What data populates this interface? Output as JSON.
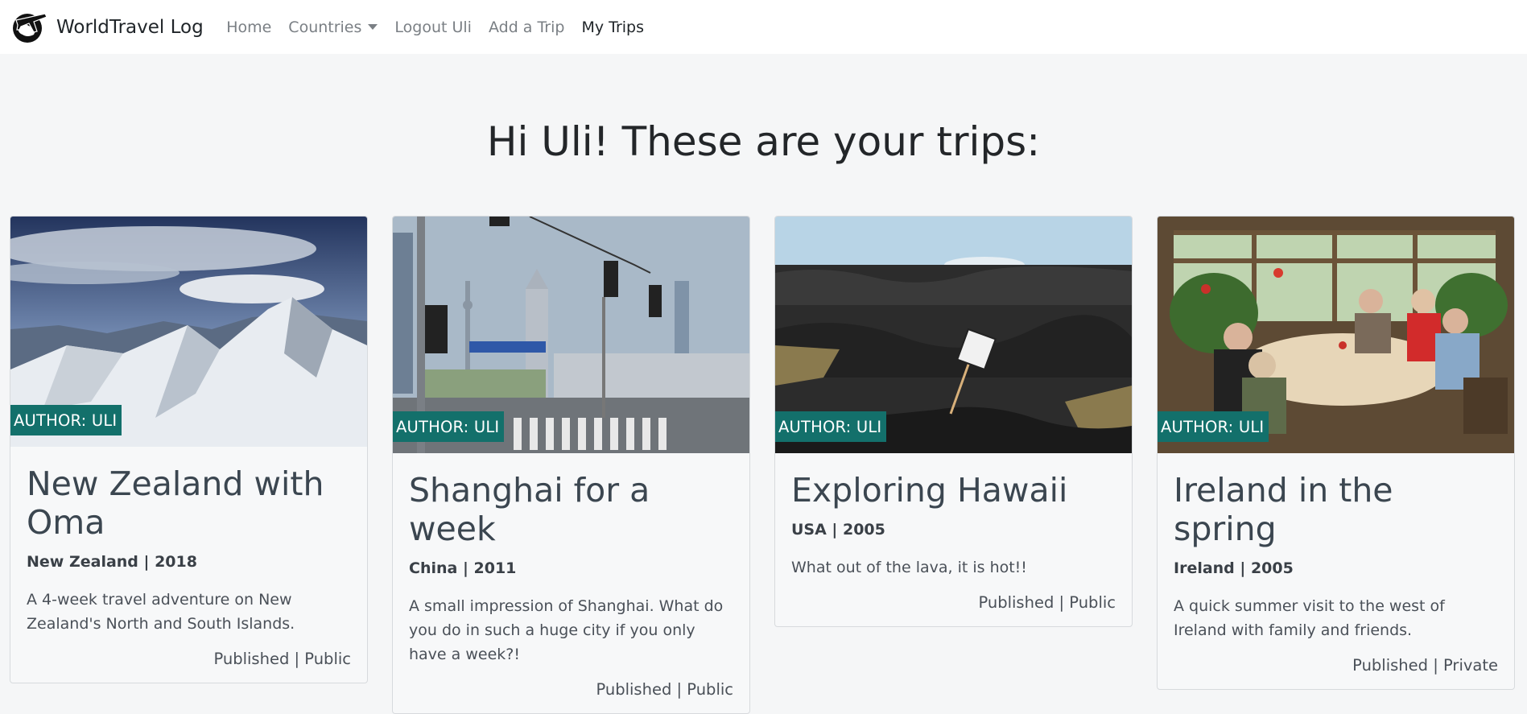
{
  "nav": {
    "brand": "WorldTravel Log",
    "links": [
      {
        "label": "Home"
      },
      {
        "label": "Countries"
      },
      {
        "label": "Logout Uli"
      },
      {
        "label": "Add a Trip"
      },
      {
        "label": "My Trips"
      }
    ]
  },
  "heading": "Hi Uli! These are your trips:",
  "trips": [
    {
      "author": "AUTHOR: ULI",
      "title": "New Zealand with Oma",
      "sub": "New Zealand | 2018",
      "desc": "A 4-week travel adventure on New Zealand's North and South Islands.",
      "status": "Published | Public"
    },
    {
      "author": "AUTHOR: ULI",
      "title": "Shanghai for a week",
      "sub": "China | 2011",
      "desc": "A small impression of Shanghai. What do you do in such a huge city if you only have a week?!",
      "status": "Published | Public"
    },
    {
      "author": "AUTHOR: ULI",
      "title": "Exploring Hawaii",
      "sub": "USA | 2005",
      "desc": "What out of the lava, it is hot!!",
      "status": "Published | Public"
    },
    {
      "author": "AUTHOR: ULI",
      "title": "Ireland in the spring",
      "sub": "Ireland | 2005",
      "desc": "A quick summer visit to the west of Ireland with family and friends.",
      "status": "Published | Private"
    }
  ],
  "colors": {
    "badge": "#13706b",
    "nav_bg": "#ffffff",
    "page_bg": "#f5f6f7"
  }
}
